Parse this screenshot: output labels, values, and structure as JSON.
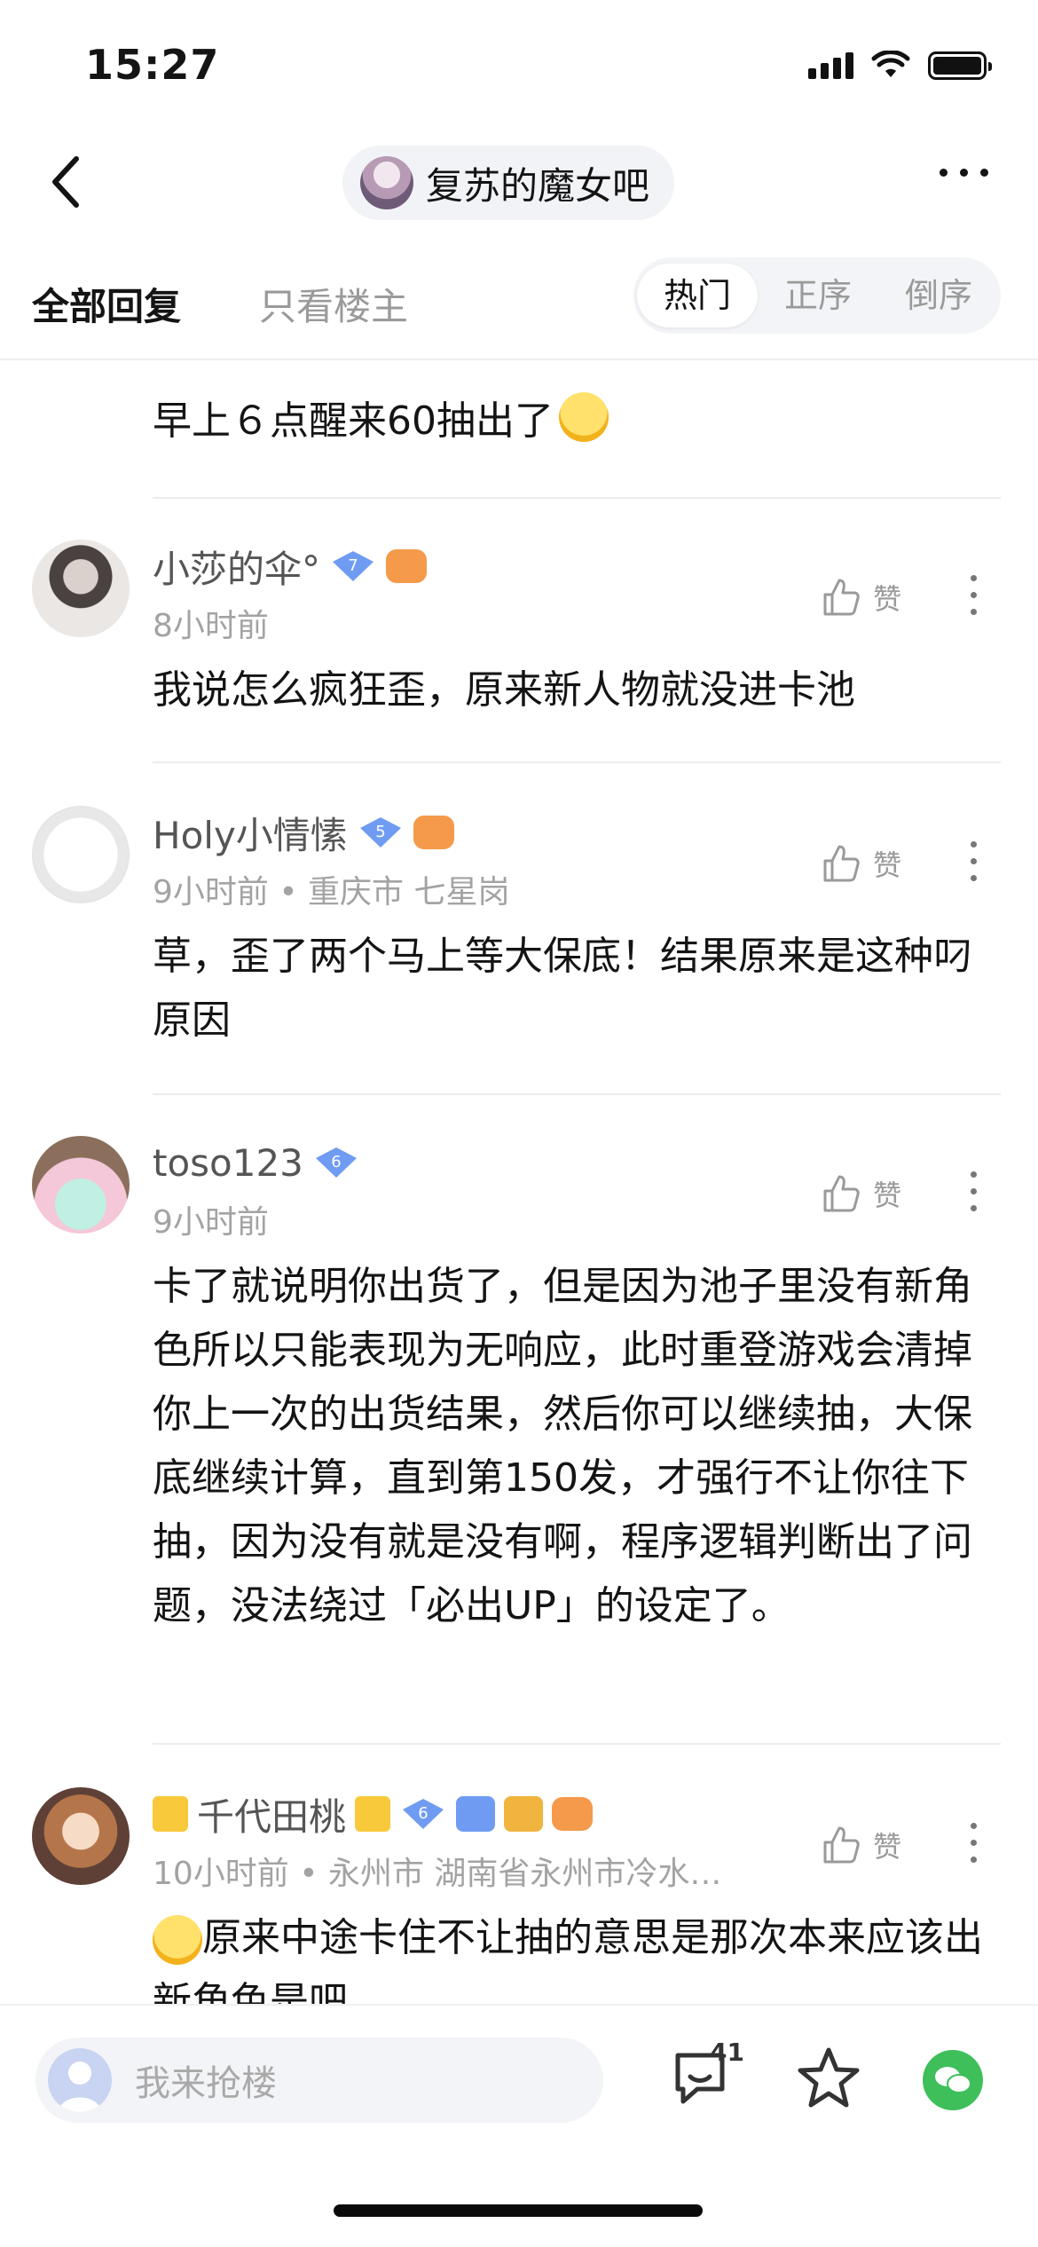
{
  "status": {
    "time": "15:27"
  },
  "nav": {
    "forum_name": "复苏的魔女吧"
  },
  "tabs": {
    "all": "全部回复",
    "op_only": "只看楼主",
    "sort": [
      "热门",
      "正序",
      "倒序"
    ]
  },
  "top_comment": {
    "text": "早上６点醒来60抽出了"
  },
  "comments": [
    {
      "user": "小莎的伞°",
      "level": "7",
      "time": "8小时前",
      "location": "",
      "text": "我说怎么疯狂歪，原来新人物就没进卡池",
      "like": "赞"
    },
    {
      "user": "Holy小情愫",
      "level": "5",
      "time": "9小时前",
      "location": "重庆市 七星岗",
      "text": "草，歪了两个马上等大保底！结果原来是这种叼原因",
      "like": "赞"
    },
    {
      "user": "toso123",
      "level": "6",
      "time": "9小时前",
      "location": "",
      "text": "卡了就说明你出货了，但是因为池子里没有新角色所以只能表现为无响应，此时重登游戏会清掉你上一次的出货结果，然后你可以继续抽，大保底继续计算，直到第150发，才强行不让你往下抽，因为没有就是没有啊，程序逻辑判断出了问题，没法绕过「必出UP」的设定了。",
      "like": "赞"
    },
    {
      "user": "千代田桃",
      "level": "6",
      "time": "10小时前",
      "location": "永州市 湖南省永州市冷水…",
      "text": "原来中途卡住不让抽的意思是那次本来应该出新角色是吧",
      "like": "赞"
    }
  ],
  "bottom": {
    "input_placeholder": "我来抢楼",
    "reply_count": "41"
  },
  "colors": {
    "badge_blue": "#6f9cf2",
    "like_gray": "#9a9a9a",
    "share_green": "#3ebf5a"
  }
}
